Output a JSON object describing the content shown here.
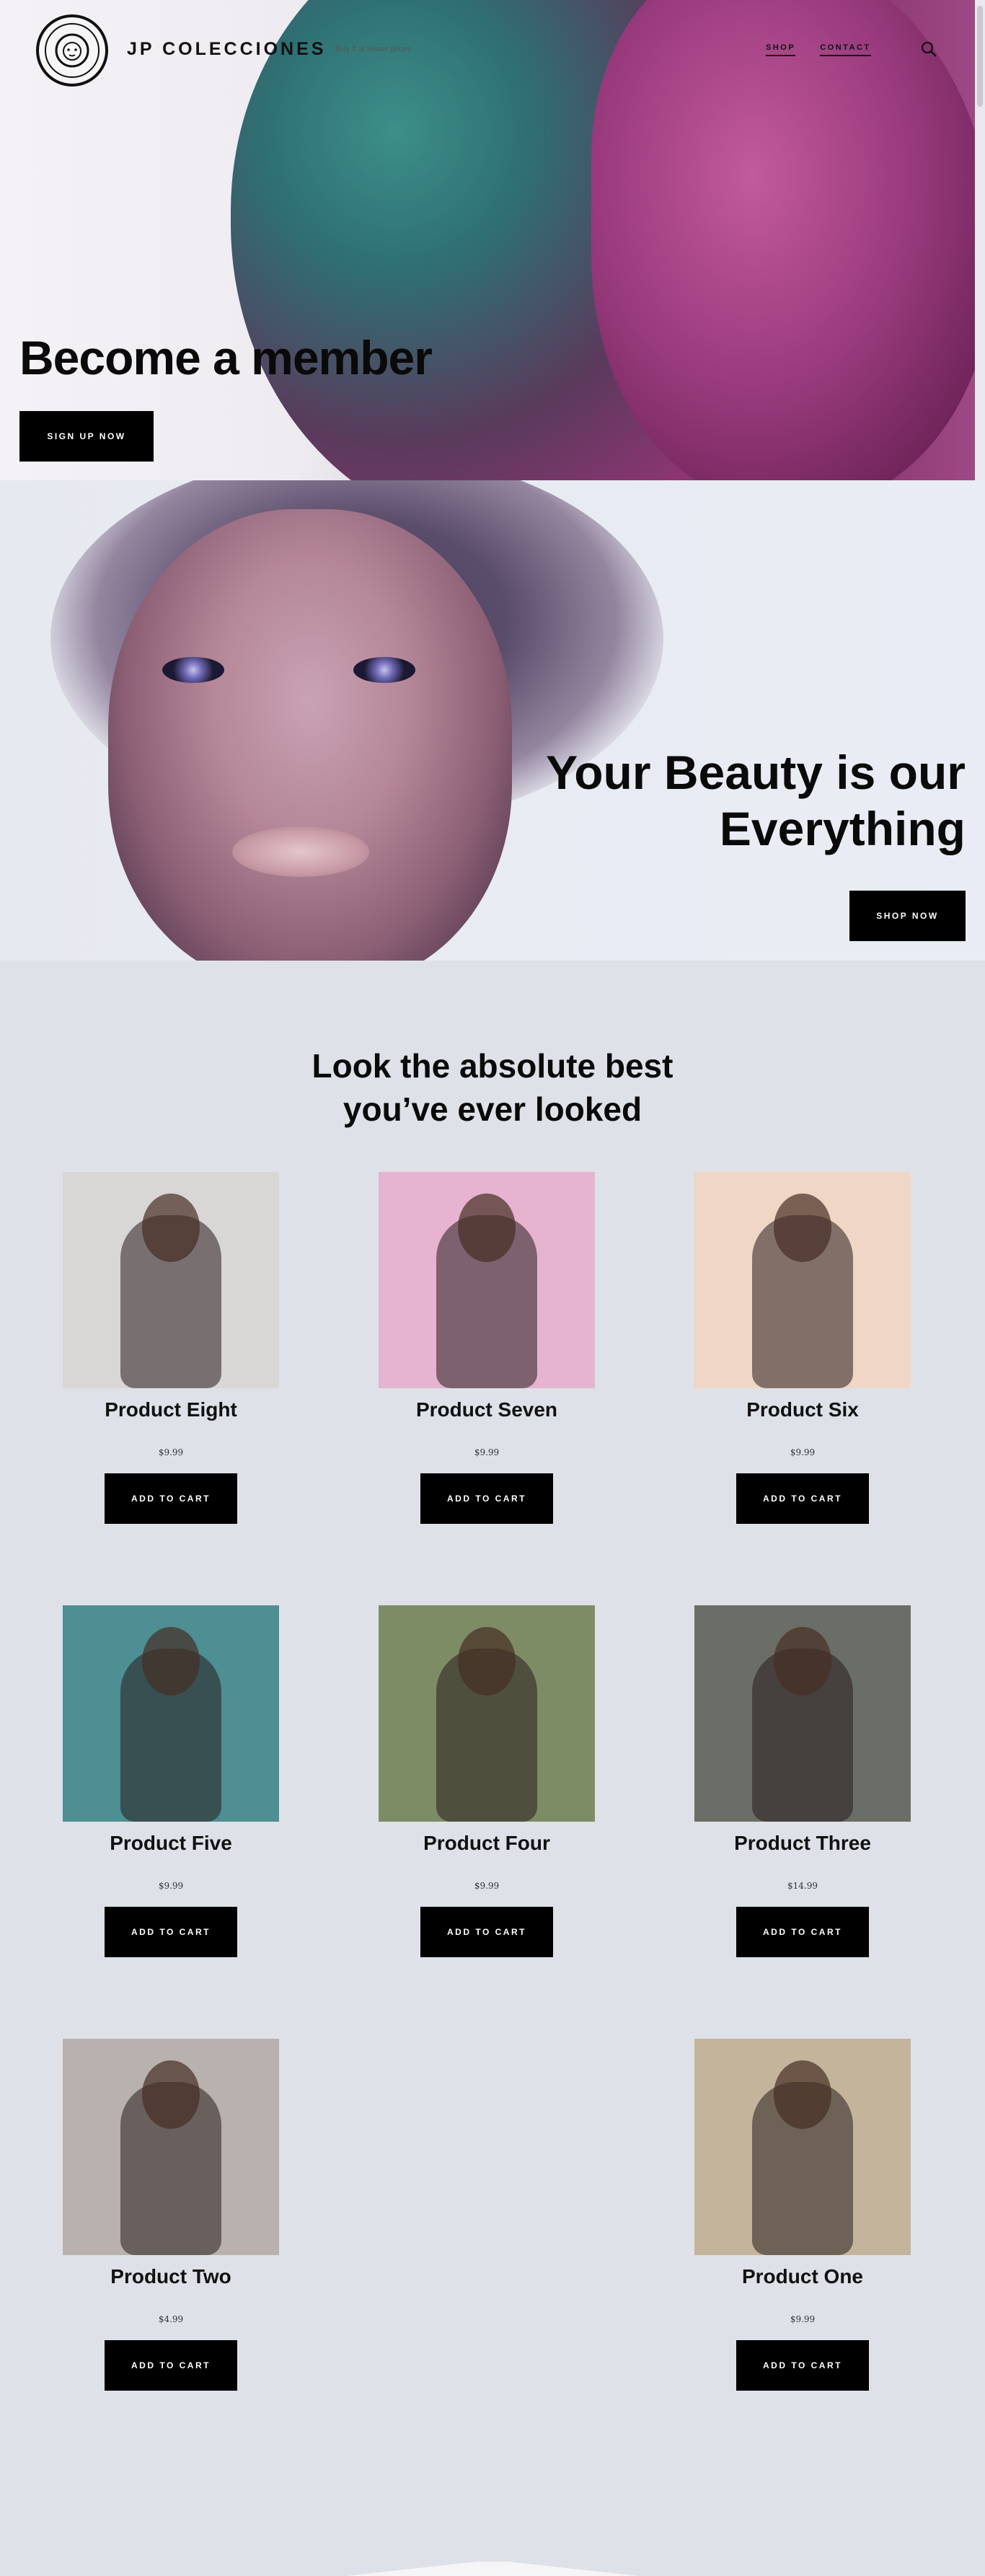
{
  "header": {
    "brand": "JP COLECCIONES",
    "tagline": "Buy it at lesser prices",
    "nav": [
      "SHOP",
      "CONTACT"
    ],
    "search_icon": "search-icon",
    "logo_icon": "lion-logo-icon"
  },
  "hero1": {
    "title": "Become a member",
    "button": "SIGN UP NOW"
  },
  "hero2": {
    "title": "Your Beauty is our Everything",
    "button": "SHOP NOW"
  },
  "products_section": {
    "title": "Look the absolute best you’ve ever looked",
    "cart_label": "ADD TO CART",
    "items": [
      {
        "name": "Product Eight",
        "price": "$9.99",
        "bg": "#d9d6d6"
      },
      {
        "name": "Product Seven",
        "price": "$9.99",
        "bg": "#e6b3d0"
      },
      {
        "name": "Product Six",
        "price": "$9.99",
        "bg": "#f0d6c4"
      },
      {
        "name": "Product Five",
        "price": "$9.99",
        "bg": "#4d8f93"
      },
      {
        "name": "Product Four",
        "price": "$9.99",
        "bg": "#7e8c66"
      },
      {
        "name": "Product Three",
        "price": "$14.99",
        "bg": "#6b6e66"
      },
      {
        "name": "Product Two",
        "price": "$4.99",
        "bg": "#b8b1ad"
      },
      {
        "name": "Product One",
        "price": "$9.99",
        "bg": "#c4b49c"
      }
    ]
  },
  "colors": {
    "page_bg": "#dfe1e8",
    "button_bg": "#000000",
    "button_text": "#ffffff"
  }
}
